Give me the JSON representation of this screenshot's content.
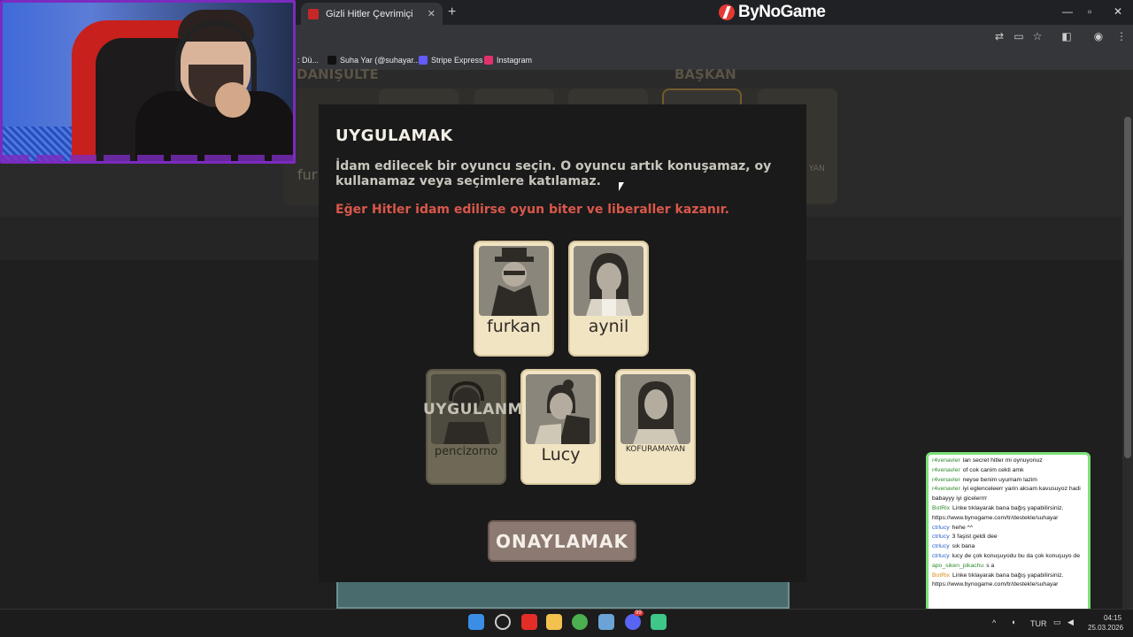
{
  "browser": {
    "tab_title": "Gizli Hitler Çevrimiçi",
    "tab_close": "✕",
    "new_tab": "+",
    "brand": "ByNoGame",
    "bookmarks": [
      {
        "label": ": Dü...",
        "color": "#666666"
      },
      {
        "label": "Suha Yar (@suhayar...",
        "color": "#111111"
      },
      {
        "label": "Stripe Express",
        "color": "#635bff"
      },
      {
        "label": "Instagram",
        "color": "#e1306c"
      }
    ]
  },
  "background": {
    "header_left": "DANIŞULTE",
    "header_right": "BAŞKAN",
    "partial_name_left": "fur",
    "partial_name_right": "YAN"
  },
  "modal": {
    "title": "UYGULAMAK",
    "description": "İdam edilecek bir oyuncu seçin. O oyuncu artık konuşamaz, oy kullanamaz veya seçimlere katılamaz.",
    "warning": "Eğer Hitler idam edilirse oyun biter ve liberaller kazanır.",
    "confirm_label": "ONAYLAMAK",
    "dead_label": "UYGULANMIŞ",
    "players": [
      {
        "name": "furkan",
        "state": "alive"
      },
      {
        "name": "aynil",
        "state": "alive"
      },
      {
        "name": "pencizorno",
        "state": "executed"
      },
      {
        "name": "Lucy",
        "state": "alive"
      },
      {
        "name": "KOFURAMAYAN",
        "state": "alive"
      }
    ]
  },
  "chat": {
    "messages": [
      {
        "user": "r4venavler",
        "text": "lan secret hitler mi oynuyonuz"
      },
      {
        "user": "r4venavler",
        "text": "of cok canim cekti amk"
      },
      {
        "user": "r4venavler",
        "text": "neyse benim uyumam lazim"
      },
      {
        "user": "r4venavler",
        "text": "iyi eglenceleerr yarin aksam kavusuyoz hadi babayyy iyi gicelerrrr"
      },
      {
        "user": "BotRix",
        "text": "Linke tıklayarak bana bağış yapabilirsiniz. https://www.bynogame.com/tr/destekle/suhayar"
      },
      {
        "user": "ctrlucy",
        "text": "hehe ^^"
      },
      {
        "user": "ctrlucy",
        "text": "3 faşist geldi dee"
      },
      {
        "user": "ctrlucy",
        "text": "sık bana"
      },
      {
        "user": "ctrlucy",
        "text": "lucy de çok konuşuyodu bu da çok konuşuyo de"
      },
      {
        "user": "apo_siken_pikachu",
        "text": "s a"
      },
      {
        "user": "BotRix",
        "text": "Linke tıklayarak bana bağış yapabilirsiniz. https://www.bynogame.com/tr/destekle/suhayar"
      }
    ]
  },
  "taskbar": {
    "lang": "TUR",
    "time": "04:15",
    "date": "25.03.2026",
    "chevron": "^",
    "badge": "99"
  }
}
